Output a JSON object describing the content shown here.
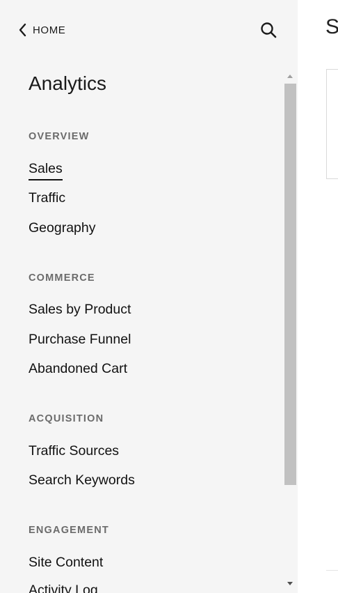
{
  "header": {
    "home_label": "HOME"
  },
  "sidebar": {
    "title": "Analytics",
    "sections": [
      {
        "title": "OVERVIEW",
        "items": [
          {
            "label": "Sales",
            "active": true
          },
          {
            "label": "Traffic"
          },
          {
            "label": "Geography"
          }
        ]
      },
      {
        "title": "COMMERCE",
        "items": [
          {
            "label": "Sales by Product"
          },
          {
            "label": "Purchase Funnel"
          },
          {
            "label": "Abandoned Cart"
          }
        ]
      },
      {
        "title": "ACQUISITION",
        "items": [
          {
            "label": "Traffic Sources"
          },
          {
            "label": "Search Keywords"
          }
        ]
      },
      {
        "title": "ENGAGEMENT",
        "items": [
          {
            "label": "Site Content"
          },
          {
            "label": "Activity Log"
          }
        ]
      }
    ]
  },
  "content": {
    "heading": "S"
  },
  "icons": {
    "back": "chevron-left-icon",
    "search": "search-icon"
  },
  "colors": {
    "sidebar_bg": "#f5f5f5",
    "scroll_thumb": "#c1c1c1",
    "section_title": "#6b6b6b"
  }
}
